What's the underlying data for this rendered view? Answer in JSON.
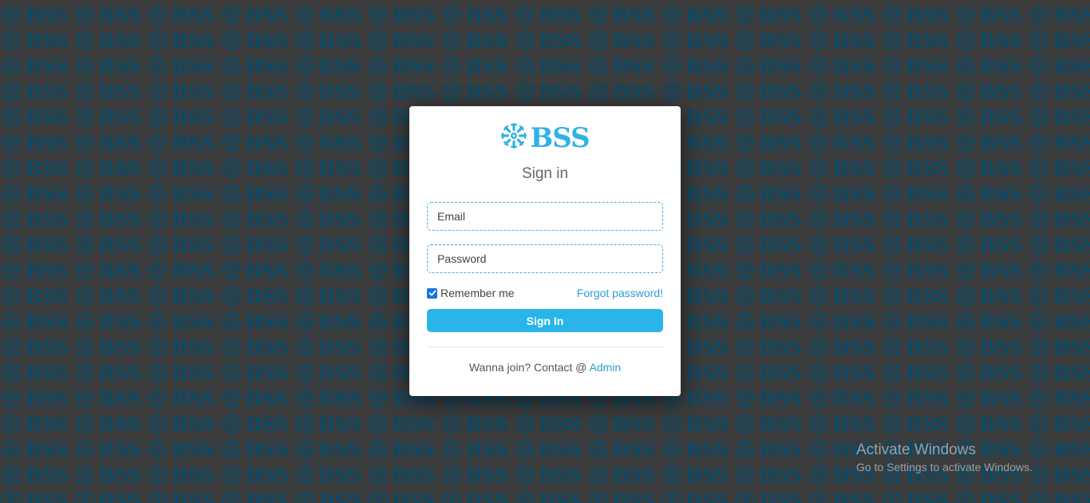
{
  "background": {
    "pattern_text": "BSS",
    "pattern_icon": "snowflake-icon",
    "color": "#3c3c3c",
    "pattern_color": "#0b4a66"
  },
  "login": {
    "logo_text": "BSS",
    "logo_icon": "snowflake-icon",
    "title": "Sign in",
    "email_placeholder": "Email",
    "password_placeholder": "Password",
    "remember_label": "Remember me",
    "remember_checked": true,
    "forgot_label": "Forgot password!",
    "signin_label": "Sign In",
    "join_text": "Wanna join? Contact @ ",
    "admin_link": "Admin",
    "accent_color": "#29b5ea"
  },
  "watermark": {
    "line1": "Activate Windows",
    "line2": "Go to Settings to activate Windows."
  }
}
